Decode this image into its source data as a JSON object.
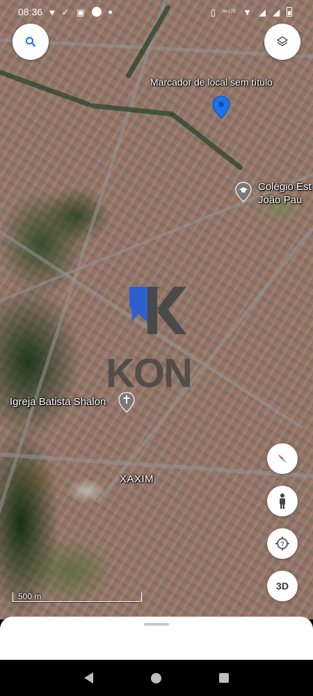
{
  "status_bar": {
    "time": "08:36",
    "lte_label": "Vo LTE"
  },
  "map": {
    "place_labels": {
      "marker": "Marcador de local sem título",
      "school": "Colégio Est",
      "school_line2": "João Pau",
      "church": "Igreja Batista Shalon",
      "neighborhood": "XAXIM"
    },
    "scale_label": "500 m"
  },
  "watermark": {
    "text": "KON",
    "colors": {
      "blue": "#2f5fd0",
      "gray": "#4a4a4a"
    }
  },
  "controls": {
    "three_d_label": "3D"
  },
  "icons": {
    "search": "search-icon",
    "layers": "layers-icon",
    "compass": "compass-icon",
    "street_view": "pegman-icon",
    "my_location": "my-location-icon"
  },
  "colors": {
    "marker_blue": "#1a73e8",
    "icon_gray": "#555555"
  }
}
